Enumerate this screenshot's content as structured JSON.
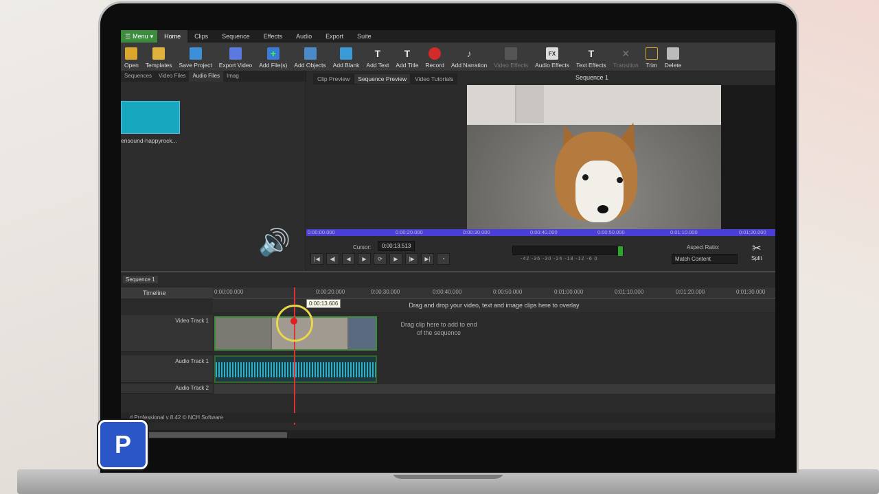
{
  "app": {
    "menu_label": "Menu",
    "tabs": [
      "Home",
      "Clips",
      "Sequence",
      "Effects",
      "Audio",
      "Export",
      "Suite"
    ],
    "status_text": "...d Professional v 8.42 © NCH Software"
  },
  "toolbar": [
    {
      "label": "Open",
      "icon": "folder-open-icon"
    },
    {
      "label": "Templates",
      "icon": "templates-icon"
    },
    {
      "label": "Save Project",
      "icon": "save-icon"
    },
    {
      "label": "Export Video",
      "icon": "export-icon"
    },
    {
      "label": "Add File(s)",
      "icon": "add-files-icon"
    },
    {
      "label": "Add Objects",
      "icon": "add-objects-icon"
    },
    {
      "label": "Add Blank",
      "icon": "add-blank-icon"
    },
    {
      "label": "Add Text",
      "icon": "text-icon"
    },
    {
      "label": "Add Title",
      "icon": "title-icon"
    },
    {
      "label": "Record",
      "icon": "record-icon"
    },
    {
      "label": "Add Narration",
      "icon": "microphone-icon"
    },
    {
      "label": "Video Effects",
      "icon": "video-effects-icon"
    },
    {
      "label": "Audio Effects",
      "icon": "audio-effects-icon"
    },
    {
      "label": "Text Effects",
      "icon": "text-effects-icon"
    },
    {
      "label": "Transition",
      "icon": "transition-icon"
    },
    {
      "label": "Trim",
      "icon": "trim-icon"
    },
    {
      "label": "Delete",
      "icon": "trash-icon"
    }
  ],
  "media_bin": {
    "tabs": [
      "Sequences",
      "Video Files",
      "Audio Files",
      "Imag"
    ],
    "clip_name": "ensound-happyrock..."
  },
  "preview": {
    "tabs": [
      "Clip Preview",
      "Sequence Preview",
      "Video Tutorials"
    ],
    "sequence_title": "Sequence 1",
    "ruler_ticks": [
      "0:00:00.000",
      "0:00:20.000",
      "0:00:30.000",
      "0:00:40.000",
      "0:00:50.000",
      "0:01:10.000",
      "0:01:20.000"
    ],
    "cursor_label": "Cursor:",
    "cursor_value": "0:00:13.513",
    "meter_ticks": "-42 -36 -30 -24 -18 -12 -6 0",
    "aspect_label": "Aspect Ratio:",
    "aspect_value": "Match Content",
    "split_label": "Split"
  },
  "timeline": {
    "sequence_tab": "Sequence 1",
    "header_label": "Timeline",
    "ruler_ticks": [
      "0:00:00.000",
      "0:00:20.000",
      "0:00:30.000",
      "0:00:40.000",
      "0:00:50.000",
      "0:01:00.000",
      "0:01:10.000",
      "0:01:20.000",
      "0:01:30.000"
    ],
    "playhead_tooltip": "0:00:13.606",
    "overlay_hint": "Drag and drop your video, text and image clips here to overlay",
    "tracks": [
      "Video Track 1",
      "Audio Track 1",
      "Audio Track 2"
    ],
    "drop_hint": "Drag clip here to add to end of the sequence"
  }
}
